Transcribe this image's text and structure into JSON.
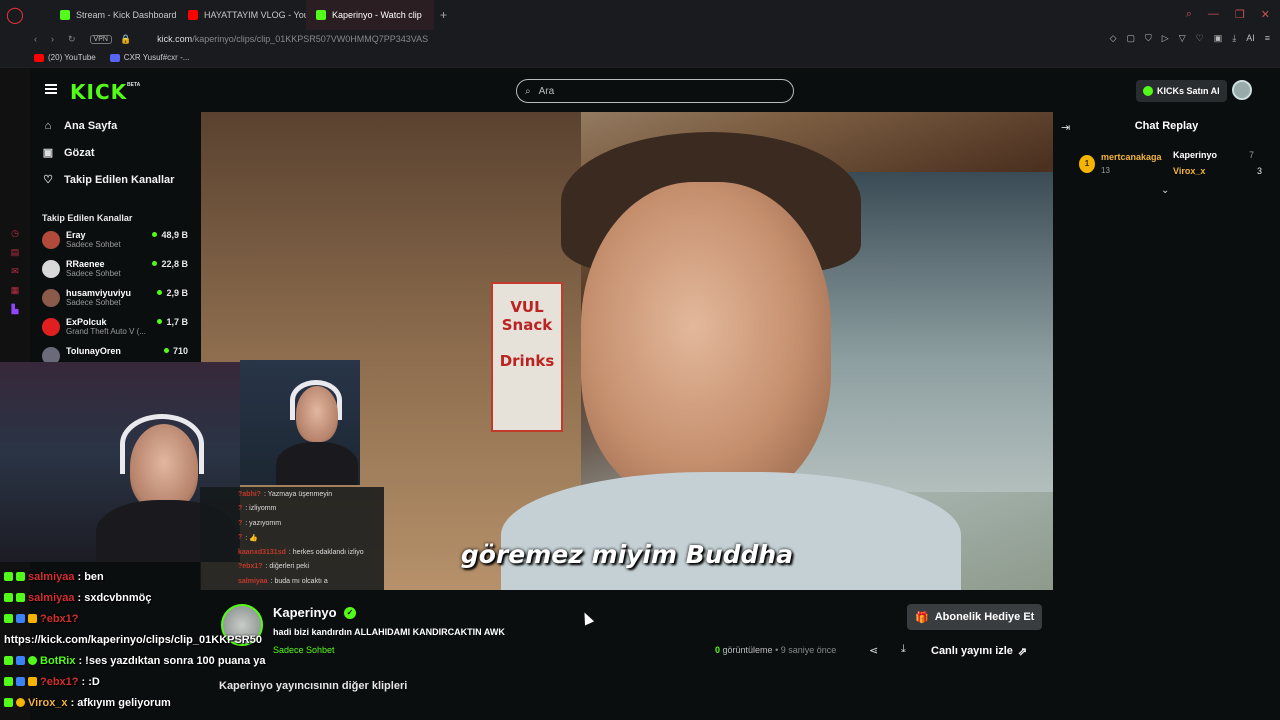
{
  "browser": {
    "tabs": [
      {
        "label": "Stream - Kick Dashboard",
        "color": "#53fc18"
      },
      {
        "label": "HAYATTAYIM VLOG - YouT",
        "color": "#ff0000"
      },
      {
        "label": "Kaperinyo - Watch clip",
        "color": "#53fc18"
      }
    ],
    "vpn_label": "VPN",
    "url_host": "kick.com",
    "url_path": "/kaperinyo/clips/clip_01KKPSR507VW0HMMQ7PP343VAS",
    "bookmarks": [
      {
        "label": "(20) YouTube",
        "color": "#ff0000"
      },
      {
        "label": "CXR Yusuf#cxr -...",
        "color": "#5865f2"
      }
    ],
    "ai_label": "AI"
  },
  "header": {
    "logo": "KICK",
    "beta": "BETA",
    "search_placeholder": "Ara",
    "kicks_button": "KICKs Satın Al"
  },
  "sidebar": {
    "nav": [
      {
        "label": "Ana Sayfa",
        "icon": "home-icon"
      },
      {
        "label": "Gözat",
        "icon": "browse-icon"
      },
      {
        "label": "Takip Edilen Kanallar",
        "icon": "heart-icon"
      }
    ],
    "followed_title": "Takip Edilen Kanallar",
    "followed": [
      {
        "name": "Eray",
        "category": "Sadece Sohbet",
        "viewers": "48,9 B",
        "color": "#b04a3a"
      },
      {
        "name": "RRaenee",
        "category": "Sadece Sohbet",
        "viewers": "22,8 B",
        "color": "#d8d8d8"
      },
      {
        "name": "husamviyuviyu",
        "category": "Sadece Sohbet",
        "viewers": "2,9 B",
        "color": "#8a5a4a"
      },
      {
        "name": "ExPolcuk",
        "category": "Grand Theft Auto V (...",
        "viewers": "1,7 B",
        "color": "#e02020"
      },
      {
        "name": "TolunayOren",
        "category": "",
        "viewers": "710",
        "color": "#6a6a7a"
      }
    ]
  },
  "video": {
    "subtitle": "göremez miyim Buddha",
    "shop_sign": "VUL Snack น้ำ Drinks"
  },
  "chat_replay": {
    "title": "Chat Replay",
    "top_gifter": {
      "rank": "1",
      "name": "mertcanakaga",
      "count": "13"
    },
    "gifters": [
      {
        "name": "Kaperinyo",
        "count": "7"
      },
      {
        "name": "Virox_x",
        "count": "3"
      }
    ]
  },
  "overlay_mini_chat": [
    {
      "user": "?abhi?",
      "msg": ": Yazmaya üşenmeyin"
    },
    {
      "user": "?",
      "msg": ": izliyomm"
    },
    {
      "user": "?",
      "msg": ": yazıyomm"
    },
    {
      "user": "?",
      "msg": ": 👍"
    },
    {
      "user": "kaanxd3131sd",
      "msg": ": herkes odaklandı izliyo"
    },
    {
      "user": "?ebx1?",
      "msg": ": diğerleri peki"
    },
    {
      "user": "salmiyaa",
      "msg": ": buda mı olcaktı a"
    }
  ],
  "stream_chat": [
    {
      "user": "salmiyaa",
      "msg": ": ben",
      "color": "#d32f2f"
    },
    {
      "user": "salmiyaa",
      "msg": ": sxdcvbnmöç",
      "color": "#d32f2f"
    },
    {
      "user": "?ebx1?",
      "msg": "",
      "color": "#d32f2f"
    },
    {
      "user": "",
      "msg": "https://kick.com/kaperinyo/clips/clip_01KKPSR50",
      "color": "#ffffff"
    },
    {
      "user": "BotRix",
      "msg": ": !ses yazdıktan sonra 100 puana ya",
      "color": "#53fc18"
    },
    {
      "user": "?ebx1?",
      "msg": ": :D",
      "color": "#d32f2f"
    },
    {
      "user": "Virox_x",
      "msg": ": afkıyım geliyorum",
      "color": "#f2b33a"
    }
  ],
  "clip_info": {
    "channel": "Kaperinyo",
    "title": "hadi bizi kandırdın ALLAHIDAMI KANDIRCAKTIN AWK",
    "category": "Sadece Sohbet",
    "gift_button": "Abonelik Hediye Et",
    "views_count": "0",
    "views_label": "görüntüleme",
    "ago": "• 9 saniye önce",
    "live_button": "Canlı yayını izle",
    "other_clips": "Kaperinyo yayıncısının diğer klipleri"
  }
}
